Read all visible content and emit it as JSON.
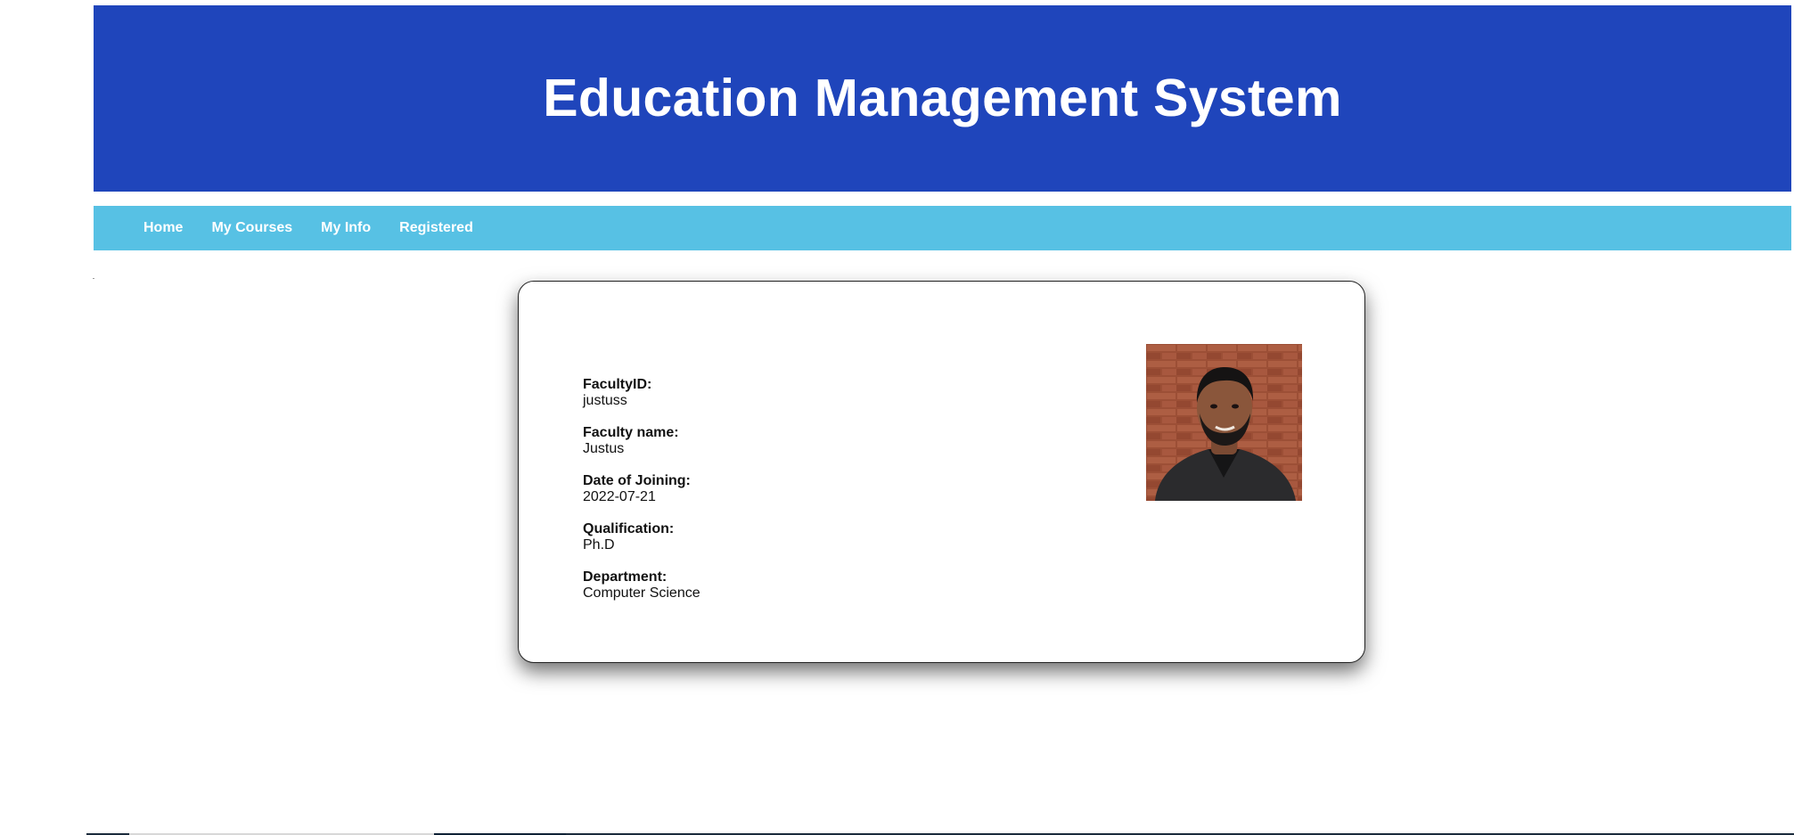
{
  "header": {
    "title": "Education Management System"
  },
  "nav": {
    "items": [
      "Home",
      "My Courses",
      "My Info",
      "Registered"
    ]
  },
  "profile": {
    "fields": [
      {
        "label": "FacultyID:",
        "value": "justuss"
      },
      {
        "label": "Faculty name:",
        "value": "Justus"
      },
      {
        "label": "Date of Joining:",
        "value": "2022-07-21"
      },
      {
        "label": "Qualification:",
        "value": "Ph.D"
      },
      {
        "label": "Department:",
        "value": "Computer Science"
      }
    ],
    "photo_icon": "faculty-photo"
  },
  "colors": {
    "banner": "#1f45bb",
    "navbar": "#57c1e4",
    "text_on_dark": "#ffffff"
  }
}
